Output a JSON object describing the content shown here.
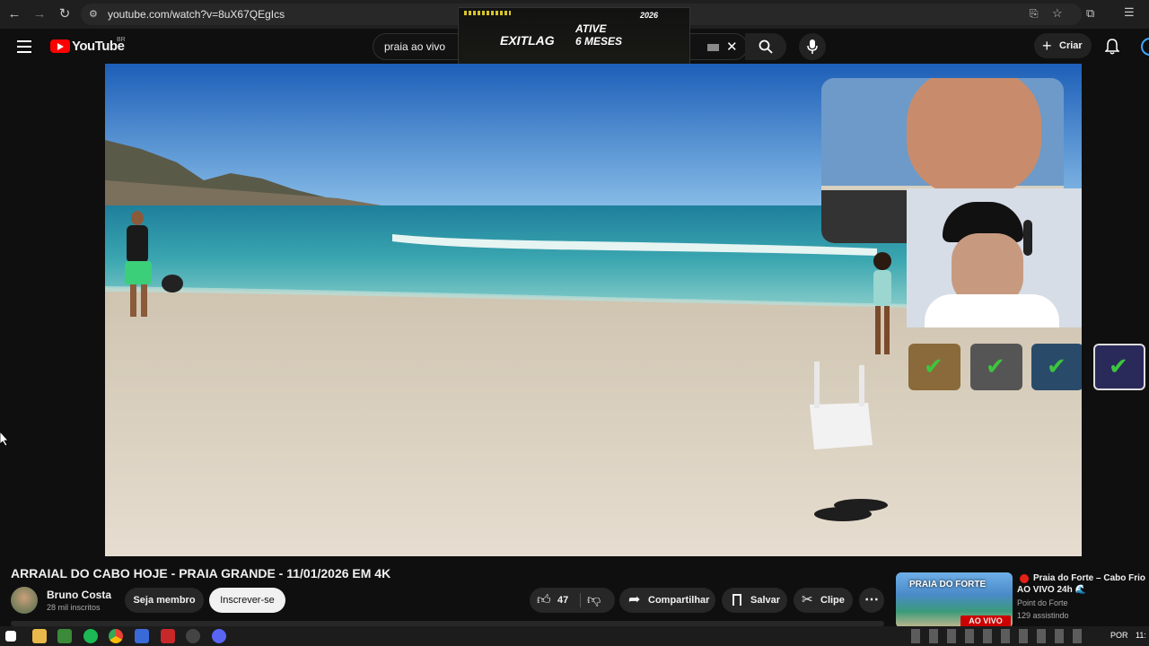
{
  "browser": {
    "url": "youtube.com/watch?v=8uX67QEgIcs"
  },
  "header": {
    "logo_text": "YouTube",
    "region": "BR",
    "search_value": "praia ao vivo",
    "create_label": "Criar"
  },
  "ad_overlay": {
    "brand": "EXITLAG",
    "line1": "ATIVE",
    "line2": "6 MESES",
    "year": "2026"
  },
  "video": {
    "title": "ARRAIAL DO CABO HOJE - PRAIA GRANDE - 11/01/2026 EM 4K"
  },
  "channel": {
    "name": "Bruno Costa",
    "subscribers": "28 mil inscritos",
    "member_label": "Seja membro",
    "subscribe_label": "Inscrever-se"
  },
  "actions": {
    "likes": "47",
    "share_label": "Compartilhar",
    "save_label": "Salvar",
    "clip_label": "Clipe"
  },
  "recommended": {
    "title": "Praia do Forte – Cabo Frio AO VIVO 24h 🌊",
    "channel": "Point do Forte",
    "watching": "129 assistindo",
    "thumb_text": "PRAIA DO FORTE",
    "thumb_badge": "AO VIVO",
    "live_badge": "AO VIVO"
  },
  "taskbar": {
    "lang": "POR",
    "time": "11:"
  },
  "colors": {
    "yt_red": "#ff0000",
    "check_green": "#3ec43e"
  }
}
